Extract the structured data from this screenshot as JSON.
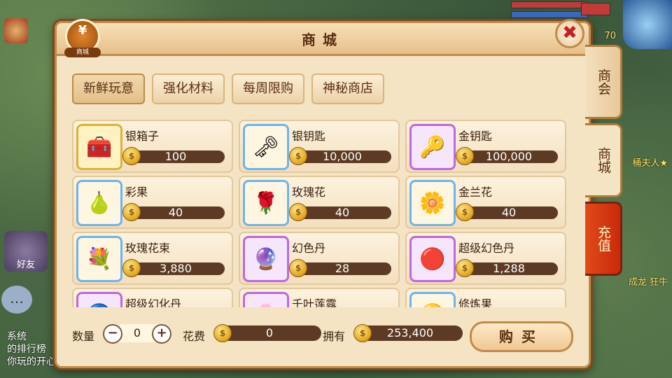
{
  "hud": {
    "friends_label": "好友",
    "chat_lines": [
      "系统",
      "的排行榜",
      "你玩的开心"
    ],
    "right_texts": [
      "70",
      "桶夫人★",
      "成龙 狂牛"
    ]
  },
  "panel": {
    "title": "商城",
    "badge_symbol": "¥",
    "badge_label": "商城",
    "close_symbol": "✖"
  },
  "tabs": [
    {
      "label": "新鲜玩意"
    },
    {
      "label": "强化材料"
    },
    {
      "label": "每周限购"
    },
    {
      "label": "神秘商店"
    }
  ],
  "items": [
    {
      "name": "银箱子",
      "price": "100",
      "icon": "silver-chest-icon",
      "glyph": "🧰",
      "frame": "gold"
    },
    {
      "name": "银钥匙",
      "price": "10,000",
      "icon": "silver-key-icon",
      "glyph": "🗝",
      "frame": "blue"
    },
    {
      "name": "金钥匙",
      "price": "100,000",
      "icon": "gold-key-icon",
      "glyph": "🔑",
      "frame": "purple"
    },
    {
      "name": "彩果",
      "price": "40",
      "icon": "rainbow-fruit-icon",
      "glyph": "🍐",
      "frame": "blue"
    },
    {
      "name": "玫瑰花",
      "price": "40",
      "icon": "rose-icon",
      "glyph": "🌹",
      "frame": "blue"
    },
    {
      "name": "金兰花",
      "price": "40",
      "icon": "orchid-icon",
      "glyph": "🌼",
      "frame": "blue"
    },
    {
      "name": "玫瑰花束",
      "price": "3,880",
      "icon": "bouquet-icon",
      "glyph": "💐",
      "frame": "blue"
    },
    {
      "name": "幻色丹",
      "price": "28",
      "icon": "purple-pill-icon",
      "glyph": "🔮",
      "frame": "purple"
    },
    {
      "name": "超级幻色丹",
      "price": "1,288",
      "icon": "red-pill-icon",
      "glyph": "🔴",
      "frame": "purple"
    },
    {
      "name": "超级幻化丹",
      "price": "",
      "icon": "blue-pill-icon",
      "glyph": "🔵",
      "frame": "purple"
    },
    {
      "name": "千叶莲露",
      "price": "",
      "icon": "lotus-dew-icon",
      "glyph": "🌸",
      "frame": "purple"
    },
    {
      "name": "修炼果",
      "price": "",
      "icon": "training-fruit-icon",
      "glyph": "🟡",
      "frame": "blue"
    }
  ],
  "bottom": {
    "quantity_label": "数量",
    "quantity_value": "0",
    "minus": "−",
    "plus": "+",
    "cost_label": "花费",
    "cost_value": "0",
    "owned_label": "拥有",
    "owned_value": "253,400",
    "buy_label": "购买"
  },
  "side_tabs": [
    {
      "label": "商会"
    },
    {
      "label": "商城"
    },
    {
      "label": "充值"
    }
  ]
}
